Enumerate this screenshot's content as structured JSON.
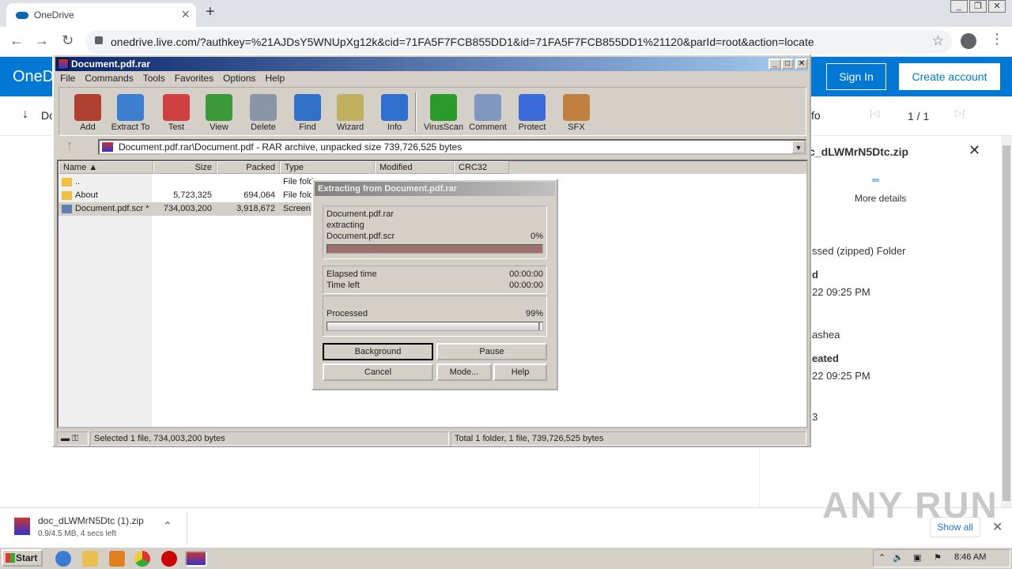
{
  "browser": {
    "tab_title": "OneDrive",
    "url": "onedrive.live.com/?authkey=%21AJDsY5WNUpXg12k&cid=71FA5F7FCB855DD1&id=71FA5F7FCB855DD1%21120&parId=root&action=locate",
    "icons": [
      "cloud-icon",
      "close-icon",
      "new-tab-icon",
      "back-icon",
      "forward-icon",
      "reload-icon",
      "lock-icon",
      "star-icon",
      "profile-icon",
      "menu-icon"
    ]
  },
  "onedrive": {
    "logo": "OneD",
    "sign_in": "Sign In",
    "create_account": "Create account",
    "download_label": "Do",
    "info_label": "fo",
    "pager": "1 / 1",
    "panel": {
      "file_name": "c_dLWMrN5Dtc.zip",
      "more_details": "More details",
      "type_value": "ssed (zipped) Folder",
      "modified_label": "d",
      "modified_value": "22 09:25 PM",
      "owner_value": "ashea",
      "created_label": "eated",
      "created_value": "22 09:25 PM",
      "trailing": "3"
    }
  },
  "winrar": {
    "title": "Document.pdf.rar",
    "menu": [
      "File",
      "Commands",
      "Tools",
      "Favorites",
      "Options",
      "Help"
    ],
    "toolbar": [
      {
        "label": "Add",
        "color": "#b04030"
      },
      {
        "label": "Extract To",
        "color": "#3c7fd0"
      },
      {
        "label": "Test",
        "color": "#d04040"
      },
      {
        "label": "View",
        "color": "#3a9a3a"
      },
      {
        "label": "Delete",
        "color": "#8a96a8"
      },
      {
        "label": "Find",
        "color": "#3070c8"
      },
      {
        "label": "Wizard",
        "color": "#c0b060"
      },
      {
        "label": "Info",
        "color": "#2f6fd0"
      },
      {
        "label": "VirusScan",
        "color": "#2a9a2a"
      },
      {
        "label": "Comment",
        "color": "#8098c0"
      },
      {
        "label": "Protect",
        "color": "#3a6ad8"
      },
      {
        "label": "SFX",
        "color": "#c08040"
      }
    ],
    "address": "Document.pdf.rar\\Document.pdf - RAR archive, unpacked size 739,726,525 bytes",
    "columns": [
      "Name",
      "Size",
      "Packed",
      "Type",
      "Modified",
      "CRC32"
    ],
    "rows": [
      {
        "name": "..",
        "size": "",
        "packed": "",
        "type": "File fold"
      },
      {
        "name": "About",
        "size": "5,723,325",
        "packed": "694,064",
        "type": "File fold"
      },
      {
        "name": "Document.pdf.scr *",
        "size": "734,003,200",
        "packed": "3,918,672",
        "type": "Screen"
      }
    ],
    "status_left": "Selected 1 file, 734,003,200 bytes",
    "status_right": "Total 1 folder, 1 file, 739,726,525 bytes"
  },
  "dialog": {
    "title": "Extracting from Document.pdf.rar",
    "archive": "Document.pdf.rar",
    "action": "extracting",
    "file": "Document.pdf.scr",
    "file_percent": "0%",
    "elapsed_label": "Elapsed time",
    "elapsed": "00:00:00",
    "left_label": "Time left",
    "left": "00:00:00",
    "processed_label": "Processed",
    "processed_percent": "99%",
    "processed_fraction": 0.99,
    "file_fraction": 0.0,
    "buttons": {
      "background": "Background",
      "pause": "Pause",
      "cancel": "Cancel",
      "mode": "Mode...",
      "help": "Help"
    }
  },
  "downloads": {
    "name": "doc_dLWMrN5Dtc (1).zip",
    "status": "0.9/4.5 MB, 4 secs left",
    "show_all": "Show all"
  },
  "watermark": "ANY RUN",
  "taskbar": {
    "start": "Start",
    "clock": "8:46 AM"
  }
}
